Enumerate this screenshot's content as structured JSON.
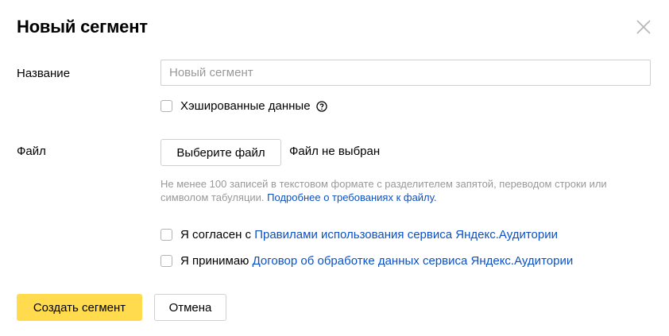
{
  "dialog": {
    "title": "Новый сегмент",
    "close_icon": "close-icon"
  },
  "form": {
    "name_label": "Название",
    "name_placeholder": "Новый сегмент",
    "name_value": "",
    "hashed_label": "Хэшированные данные",
    "hashed_checked": false,
    "help_icon": "question-circle-icon",
    "file_label": "Файл",
    "file_button": "Выберите файл",
    "file_status": "Файл не выбран",
    "file_hint": "Не менее 100 записей в текстовом формате с разделителем запятой, переводом строки или символом табуляции.",
    "file_hint_link": "Подробнее о требованиях к файлу.",
    "agree_rules_prefix": "Я согласен с",
    "agree_rules_link": "Правилами использования сервиса Яндекс.Аудитории",
    "agree_rules_checked": false,
    "accept_contract_prefix": "Я принимаю",
    "accept_contract_link": "Договор об обработке данных сервиса Яндекс.Аудитории",
    "accept_contract_checked": false
  },
  "actions": {
    "create_label": "Создать сегмент",
    "cancel_label": "Отмена"
  },
  "colors": {
    "primary_button": "#ffdb4d",
    "link": "#0b51c5",
    "hint_text": "#999999",
    "border": "#d0d0d0"
  }
}
